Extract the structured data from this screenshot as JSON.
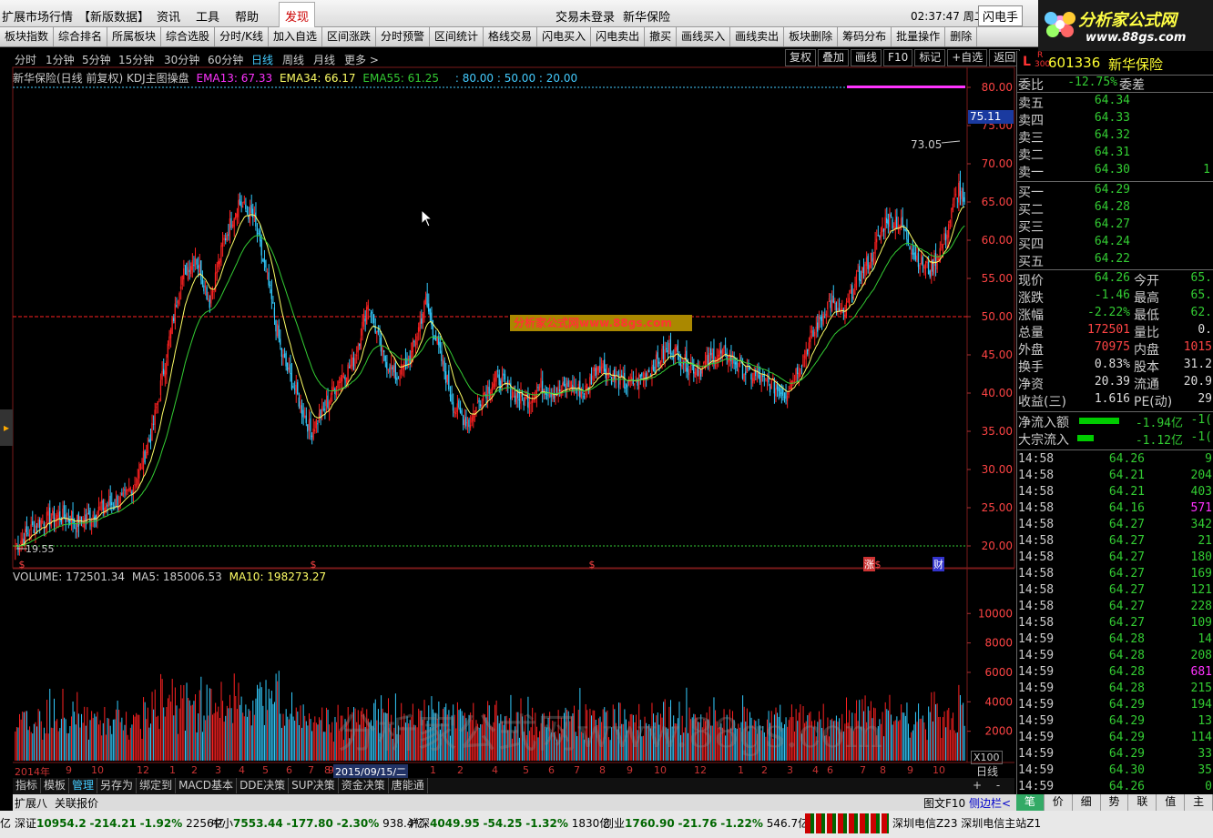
{
  "menu": {
    "items": [
      "扩展市场行情",
      "【新版数据】",
      "资讯",
      "工具",
      "帮助",
      "发现"
    ],
    "center_status": "交易未登录",
    "stock_name_title": "新华保险",
    "clock": "02:37:47 周二",
    "flash_btn": "闪电手"
  },
  "toolbar": [
    "板块指数",
    "综合排名",
    "所属板块",
    "综合选股",
    "分时/K线",
    "加入自选",
    "区间涨跌",
    "分时预警",
    "区间统计",
    "格线交易",
    "闪电买入",
    "闪电卖出",
    "撤买",
    "画线买入",
    "画线卖出",
    "板块删除",
    "筹码分布",
    "批量操作",
    "删除"
  ],
  "logo": {
    "text": "分析家公式网",
    "url": "www.88gs.com"
  },
  "periods": [
    "分时",
    "1分钟",
    "5分钟",
    "15分钟",
    "30分钟",
    "60分钟",
    "日线",
    "周线",
    "月线",
    "更多 >"
  ],
  "active_period": "日线",
  "right_tools": [
    "复权",
    "叠加",
    "画线",
    "F10",
    "标记",
    "+自选",
    "返回"
  ],
  "info": {
    "title": "新华保险(日线 前复权) KDJ主图操盘",
    "ema13": "EMA13: 67.33",
    "ema34": "EMA34: 66.17",
    "ema55": "EMA55: 61.25",
    "levels": ": 80.00 : 50.00 : 20.00"
  },
  "watermark_badge": "分析家公式网www.88gs.com",
  "watermark_big": "分析家公式网www.88gs.com",
  "price_marks": {
    "last_label": "75.11",
    "peak_label": "73.05",
    "low_label": "19.55"
  },
  "volume_info": {
    "vol": "VOLUME: 172501.34",
    "ma5": "MA5: 185006.53",
    "ma10": "MA10: 198273.27"
  },
  "vol_axis_unit": "X100",
  "event_marks": [
    "涨",
    "财"
  ],
  "date_axis": {
    "labels": [
      "2014年",
      "9",
      "10",
      "12",
      "1",
      "2",
      "3",
      "4",
      "5",
      "6",
      "7",
      "8",
      "9",
      "2015/09/15/二",
      "1",
      "2",
      "4",
      "5",
      "6",
      "7",
      "8",
      "9",
      "10",
      "12",
      "1",
      "2",
      "3",
      "4",
      "6",
      "7",
      "8",
      "9",
      "10"
    ],
    "period_label": "日线"
  },
  "bottom_tabs": [
    "指标",
    "模板",
    "管理",
    "另存为",
    "绑定到",
    "MACD基本",
    "DDE决策",
    "SUP决策",
    "资金决策",
    "唐能通"
  ],
  "bottom_tabs2": [
    "扩展八",
    "关联报价"
  ],
  "status_right": [
    "图文F10",
    "侧边栏<"
  ],
  "indexes": [
    {
      "name": "深证",
      "val": "10954.2",
      "chg": "-214.21",
      "pct": "-1.92%",
      "amt": "2256亿"
    },
    {
      "name": "中小",
      "val": "7553.44",
      "chg": "-177.80",
      "pct": "-2.30%",
      "amt": "938.4亿"
    },
    {
      "name": "沪深",
      "val": "4049.95",
      "chg": "-54.25",
      "pct": "-1.32%",
      "amt": "1830亿"
    },
    {
      "name": "创业",
      "val": "1760.90",
      "chg": "-21.76",
      "pct": "-1.22%",
      "amt": "546.7亿"
    }
  ],
  "index_prefix": "亿",
  "servers": "深圳电信Z23 深圳电信主站Z1",
  "quote": {
    "code": "601336",
    "name": "新华保险",
    "badge_l": "L",
    "badge_r": "R",
    "badge_n": "300",
    "weibi_label": "委比",
    "weibi": "-12.75%",
    "weicha_label": "委差",
    "asks": [
      {
        "l": "卖五",
        "p": "64.34"
      },
      {
        "l": "卖四",
        "p": "64.33"
      },
      {
        "l": "卖三",
        "p": "64.32"
      },
      {
        "l": "卖二",
        "p": "64.31"
      },
      {
        "l": "卖一",
        "p": "64.30",
        "v": "1"
      }
    ],
    "bids": [
      {
        "l": "买一",
        "p": "64.29"
      },
      {
        "l": "买二",
        "p": "64.28"
      },
      {
        "l": "买三",
        "p": "64.27"
      },
      {
        "l": "买四",
        "p": "64.24"
      },
      {
        "l": "买五",
        "p": "64.22"
      }
    ],
    "stats": [
      {
        "l": "现价",
        "v": "64.26",
        "l2": "今开",
        "v2": "65."
      },
      {
        "l": "涨跌",
        "v": "-1.46",
        "l2": "最高",
        "v2": "65."
      },
      {
        "l": "涨幅",
        "v": "-2.22%",
        "l2": "最低",
        "v2": "62."
      },
      {
        "l": "总量",
        "v": "172501",
        "l2": "量比",
        "v2": "0."
      },
      {
        "l": "外盘",
        "v": "70975",
        "l2": "内盘",
        "v2": "1015"
      },
      {
        "l": "换手",
        "v": "0.83%",
        "l2": "股本",
        "v2": "31.2"
      },
      {
        "l": "净资",
        "v": "20.39",
        "l2": "流通",
        "v2": "20.9"
      },
      {
        "l": "收益(三)",
        "v": "1.616",
        "l2": "PE(动)",
        "v2": "29"
      }
    ],
    "flows": [
      {
        "l": "净流入额",
        "v": "-1.94亿",
        "v2": "-1("
      },
      {
        "l": "大宗流入",
        "v": "-1.12亿",
        "v2": "-1("
      }
    ],
    "ticks": [
      {
        "t": "14:58",
        "p": "64.26",
        "q": "9"
      },
      {
        "t": "14:58",
        "p": "64.21",
        "q": "204"
      },
      {
        "t": "14:58",
        "p": "64.21",
        "q": "403"
      },
      {
        "t": "14:58",
        "p": "64.16",
        "q": "571"
      },
      {
        "t": "14:58",
        "p": "64.27",
        "q": "342"
      },
      {
        "t": "14:58",
        "p": "64.27",
        "q": "21"
      },
      {
        "t": "14:58",
        "p": "64.27",
        "q": "180"
      },
      {
        "t": "14:58",
        "p": "64.27",
        "q": "169"
      },
      {
        "t": "14:58",
        "p": "64.27",
        "q": "121"
      },
      {
        "t": "14:58",
        "p": "64.27",
        "q": "228"
      },
      {
        "t": "14:58",
        "p": "64.27",
        "q": "109"
      },
      {
        "t": "14:59",
        "p": "64.28",
        "q": "14"
      },
      {
        "t": "14:59",
        "p": "64.28",
        "q": "208"
      },
      {
        "t": "14:59",
        "p": "64.28",
        "q": "681"
      },
      {
        "t": "14:59",
        "p": "64.28",
        "q": "215"
      },
      {
        "t": "14:59",
        "p": "64.29",
        "q": "194"
      },
      {
        "t": "14:59",
        "p": "64.29",
        "q": "13"
      },
      {
        "t": "14:59",
        "p": "64.29",
        "q": "114"
      },
      {
        "t": "14:59",
        "p": "64.29",
        "q": "33"
      },
      {
        "t": "14:59",
        "p": "64.30",
        "q": "35"
      },
      {
        "t": "14:59",
        "p": "64.26",
        "q": "0"
      }
    ]
  },
  "right_tabs": [
    "笔",
    "价",
    "细",
    "势",
    "联",
    "值",
    "主"
  ],
  "chart_data": {
    "type": "candlestick",
    "price_axis": {
      "min": 20,
      "max": 80,
      "ticks": [
        "80.00",
        "75.00",
        "70.00",
        "65.00",
        "60.00",
        "55.00",
        "50.00",
        "45.00",
        "40.00",
        "35.00",
        "30.00",
        "25.00",
        "20.00"
      ]
    },
    "volume_axis": {
      "ticks": [
        "10000",
        "8000",
        "6000",
        "4000",
        "2000"
      ],
      "unit": "X100"
    },
    "close_anchors": [
      [
        0,
        20
      ],
      [
        15,
        23
      ],
      [
        30,
        24
      ],
      [
        45,
        23
      ],
      [
        60,
        25
      ],
      [
        75,
        26
      ],
      [
        85,
        29
      ],
      [
        95,
        35
      ],
      [
        105,
        45
      ],
      [
        115,
        55
      ],
      [
        125,
        58
      ],
      [
        135,
        52
      ],
      [
        145,
        60
      ],
      [
        155,
        65
      ],
      [
        165,
        63
      ],
      [
        175,
        55
      ],
      [
        185,
        45
      ],
      [
        195,
        40
      ],
      [
        205,
        35
      ],
      [
        215,
        38
      ],
      [
        225,
        42
      ],
      [
        235,
        44
      ],
      [
        245,
        52
      ],
      [
        255,
        45
      ],
      [
        265,
        42
      ],
      [
        275,
        45
      ],
      [
        285,
        52
      ],
      [
        295,
        45
      ],
      [
        305,
        38
      ],
      [
        315,
        36
      ],
      [
        325,
        40
      ],
      [
        335,
        42
      ],
      [
        345,
        40
      ],
      [
        355,
        39
      ],
      [
        365,
        41
      ],
      [
        375,
        40
      ],
      [
        385,
        41
      ],
      [
        395,
        40
      ],
      [
        405,
        44
      ],
      [
        415,
        42
      ],
      [
        425,
        41
      ],
      [
        435,
        42
      ],
      [
        445,
        44
      ],
      [
        455,
        46
      ],
      [
        465,
        44
      ],
      [
        475,
        43
      ],
      [
        485,
        45
      ],
      [
        495,
        45
      ],
      [
        505,
        43
      ],
      [
        515,
        42
      ],
      [
        525,
        41
      ],
      [
        535,
        40
      ],
      [
        545,
        44
      ],
      [
        555,
        48
      ],
      [
        565,
        52
      ],
      [
        575,
        50
      ],
      [
        585,
        55
      ],
      [
        595,
        58
      ],
      [
        605,
        63
      ],
      [
        615,
        62
      ],
      [
        625,
        58
      ],
      [
        635,
        56
      ],
      [
        645,
        60
      ],
      [
        655,
        67
      ],
      [
        659,
        64
      ]
    ],
    "ema13_last": "67.33",
    "ema34_last": "66.17",
    "ema55_last": "61.25"
  }
}
